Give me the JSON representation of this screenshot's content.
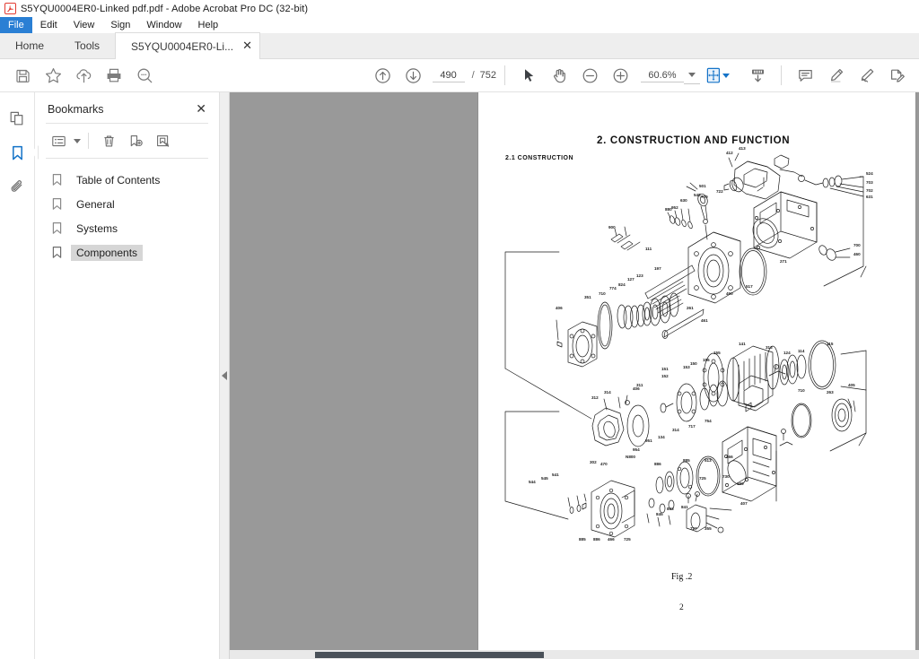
{
  "window": {
    "title": "S5YQU0004ER0-Linked pdf.pdf - Adobe Acrobat Pro DC (32-bit)",
    "app_icon": "acrobat-icon"
  },
  "menubar": {
    "items": [
      {
        "label": "File",
        "active": true
      },
      {
        "label": "Edit",
        "active": false
      },
      {
        "label": "View",
        "active": false
      },
      {
        "label": "Sign",
        "active": false
      },
      {
        "label": "Window",
        "active": false
      },
      {
        "label": "Help",
        "active": false
      }
    ]
  },
  "tabs": [
    {
      "label": "Home",
      "type": "home",
      "active": false
    },
    {
      "label": "Tools",
      "type": "tools",
      "active": false
    },
    {
      "label": "S5YQU0004ER0-Li...",
      "type": "document",
      "active": true,
      "close": "✕"
    }
  ],
  "toolbar": {
    "left_buttons": [
      {
        "name": "save-icon",
        "tooltip": "Save"
      },
      {
        "name": "star-icon",
        "tooltip": "Add to favorites"
      },
      {
        "name": "cloud-upload-icon",
        "tooltip": "Upload to cloud"
      },
      {
        "name": "print-icon",
        "tooltip": "Print"
      },
      {
        "name": "search-icon",
        "tooltip": "Find"
      }
    ],
    "page_prev": "previous-page-icon",
    "page_next": "next-page-icon",
    "page_current": "490",
    "page_separator": "/",
    "page_total": "752",
    "select_tool": "cursor-select-icon",
    "hand_tool": "hand-pan-icon",
    "zoom_out": "zoom-out-icon",
    "zoom_in": "zoom-in-icon",
    "zoom_value": "60.6%",
    "fit_page_icon": "fit-page-icon",
    "scroll_mode_icon": "scroll-mode-icon",
    "comment_icon": "comment-icon",
    "highlight_icon": "highlighter-icon",
    "draw_icon": "pen-draw-icon",
    "sign_icon": "sign-document-icon",
    "accent_color": "#1473c8"
  },
  "navrail": {
    "items": [
      {
        "name": "page-thumbnails-icon",
        "label": "Page Thumbnails",
        "active": false
      },
      {
        "name": "bookmarks-icon",
        "label": "Bookmarks",
        "active": true
      },
      {
        "name": "attachments-icon",
        "label": "Attachments",
        "active": false
      }
    ],
    "active_color": "#1473c8"
  },
  "bookmarks_panel": {
    "title": "Bookmarks",
    "close_label": "✕",
    "tools": [
      {
        "name": "bookmark-options-icon",
        "label": "Options"
      },
      {
        "name": "delete-bookmark-icon",
        "label": "Delete"
      },
      {
        "name": "new-bookmark-icon",
        "label": "New Bookmark"
      },
      {
        "name": "edit-bookmark-icon",
        "label": "Edit Bookmark"
      }
    ],
    "items": [
      {
        "label": "Table of Contents",
        "selected": false
      },
      {
        "label": "General",
        "selected": false
      },
      {
        "label": "Systems",
        "selected": false
      },
      {
        "label": "Components",
        "selected": true
      }
    ],
    "selection_color": "#d6d6d6"
  },
  "collapse_handle": {
    "name": "collapse-panel-handle",
    "direction": "left"
  },
  "document": {
    "background_color": "#999999",
    "page_color": "#ffffff",
    "heading_number": "2.",
    "heading_title": "2.   CONSTRUCTION AND FUNCTION",
    "subheading": "2.1   CONSTRUCTION",
    "figure_caption": "Fig .2",
    "page_number": "2",
    "figure_description": "Exploded assembly drawing of a hydraulic piston pump showing numbered component callouts",
    "callout_numbers": [
      "412",
      "413",
      "524",
      "703",
      "702",
      "631",
      "501",
      "548",
      "722",
      "709",
      "630",
      "880",
      "952",
      "900",
      "700",
      "460",
      "271",
      "517",
      "490",
      "111",
      "197",
      "123",
      "127",
      "824",
      "774",
      "710",
      "351",
      "406",
      "261",
      "461",
      "115",
      "114",
      "313",
      "141",
      "155",
      "156",
      "151",
      "152",
      "153",
      "311",
      "312",
      "314",
      "406",
      "710",
      "263",
      "754",
      "717",
      "314",
      "134",
      "951",
      "954",
      "302",
      "470",
      "544",
      "545",
      "541",
      "885",
      "886",
      "513",
      "466",
      "725",
      "730",
      "190",
      "407",
      "727",
      "355",
      "841",
      "843",
      "845",
      "841",
      "886",
      "885",
      "466",
      "725"
    ]
  },
  "scrollbar": {
    "name": "horizontal-scrollbar",
    "thumb_color": "#4a5159"
  }
}
